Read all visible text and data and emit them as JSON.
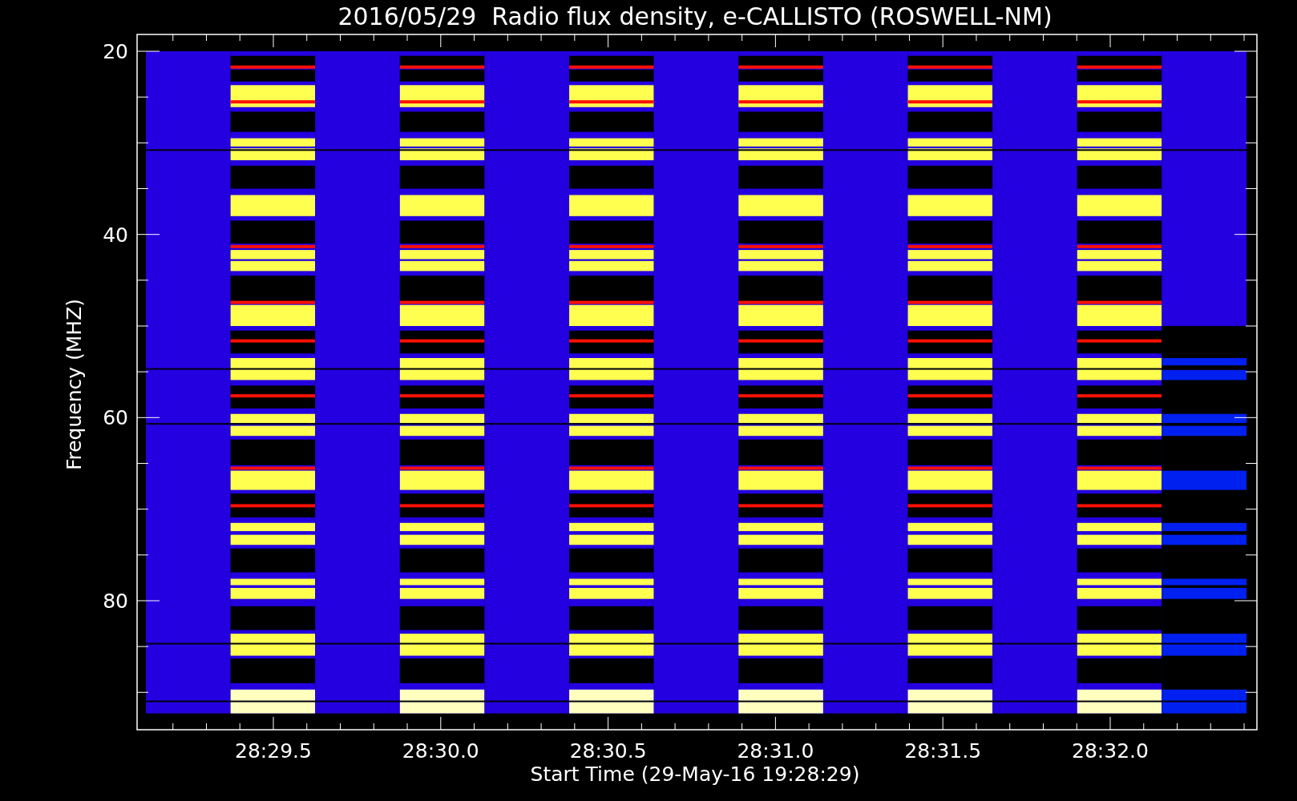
{
  "title": "2016/05/29  Radio flux density, e-CALLISTO (ROSWELL-NM)",
  "y_axis": {
    "label": "Frequency (MHZ)",
    "ticks": [
      "20",
      "40",
      "60",
      "80"
    ]
  },
  "x_axis": {
    "label": "Start Time (29-May-16 19:28:29)",
    "ticks": [
      "28:29.5",
      "28:30.0",
      "28:30.5",
      "28:31.0",
      "28:31.5",
      "28:32.0"
    ]
  }
}
